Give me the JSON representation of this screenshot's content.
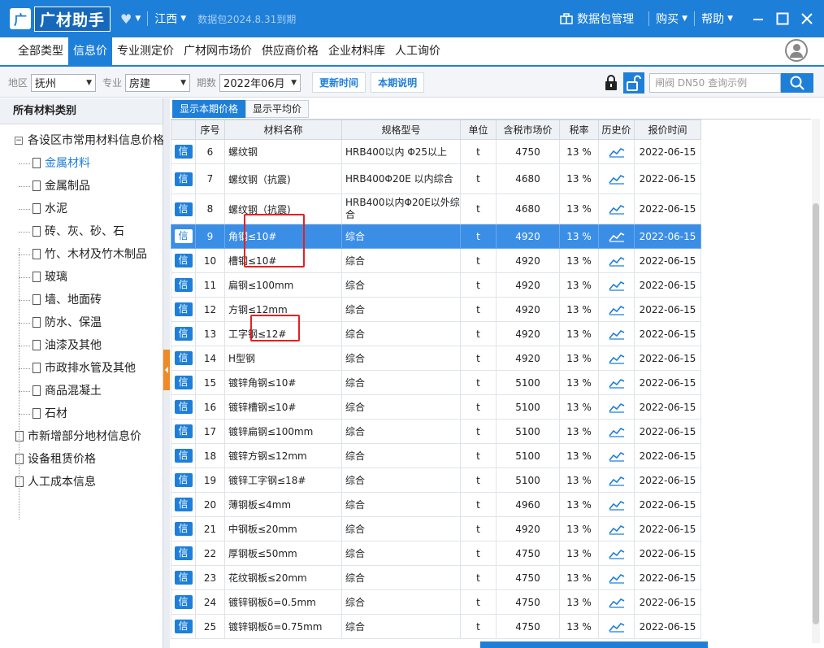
{
  "app": {
    "logo_mark": "广",
    "name": "广材助手",
    "region": "江西",
    "expiry": "数据包2024.8.31到期",
    "data_pkg": "数据包管理",
    "buy": "购买",
    "help": "帮助"
  },
  "menu": [
    "全部类型",
    "信息价",
    "专业测定价",
    "广材网市场价",
    "供应商价格",
    "企业材料库",
    "人工询价"
  ],
  "filters": {
    "region_label": "地区",
    "region_value": "抚州",
    "major_label": "专业",
    "major_value": "房建",
    "period_label": "期数",
    "period_value": "2022年06月",
    "update_time": "更新时间",
    "period_note": "本期说明",
    "search_placeholder": "闸阀 DN50 查询示例"
  },
  "tree": {
    "header": "所有材料类别",
    "root": "各设区市常用材料信息价格",
    "children": [
      "金属材料",
      "金属制品",
      "水泥",
      "砖、灰、砂、石",
      "竹、木材及竹木制品",
      "玻璃",
      "墙、地面砖",
      "防水、保温",
      "油漆及其他",
      "市政排水管及其他",
      "商品混凝土",
      "石材"
    ],
    "roots": [
      "市新增部分地材信息价",
      "设备租赁价格",
      "人工成本信息"
    ]
  },
  "subtabs": [
    "显示本期价格",
    "显示平均价"
  ],
  "table": {
    "headers": [
      "",
      "序号",
      "材料名称",
      "规格型号",
      "单位",
      "含税市场价",
      "税率",
      "历史价",
      "报价时间"
    ],
    "badge": "信",
    "rows": [
      {
        "no": "6",
        "name": "螺纹钢",
        "spec": "HRB400以内 Φ25以上",
        "unit": "t",
        "price": "4750",
        "tax": "13 %",
        "date": "2022-06-15"
      },
      {
        "no": "7",
        "name": "螺纹钢（抗震)",
        "spec": "HRB400Φ20E 以内综合",
        "unit": "t",
        "price": "4680",
        "tax": "13 %",
        "date": "2022-06-15"
      },
      {
        "no": "8",
        "name": "螺纹钢（抗震)",
        "spec": "HRB400以内Φ20E以外综合",
        "unit": "t",
        "price": "4680",
        "tax": "13 %",
        "date": "2022-06-15"
      },
      {
        "no": "9",
        "name": "角钢≤10#",
        "spec": "综合",
        "unit": "t",
        "price": "4920",
        "tax": "13 %",
        "date": "2022-06-15"
      },
      {
        "no": "10",
        "name": "槽钢≤10#",
        "spec": "综合",
        "unit": "t",
        "price": "4920",
        "tax": "13 %",
        "date": "2022-06-15"
      },
      {
        "no": "11",
        "name": "扁钢≤100mm",
        "spec": "综合",
        "unit": "t",
        "price": "4920",
        "tax": "13 %",
        "date": "2022-06-15"
      },
      {
        "no": "12",
        "name": "方钢≤12mm",
        "spec": "综合",
        "unit": "t",
        "price": "4920",
        "tax": "13 %",
        "date": "2022-06-15"
      },
      {
        "no": "13",
        "name": "工字钢≤12#",
        "spec": "综合",
        "unit": "t",
        "price": "4920",
        "tax": "13 %",
        "date": "2022-06-15"
      },
      {
        "no": "14",
        "name": "H型钢",
        "spec": "综合",
        "unit": "t",
        "price": "4920",
        "tax": "13 %",
        "date": "2022-06-15"
      },
      {
        "no": "15",
        "name": "镀锌角钢≤10#",
        "spec": "综合",
        "unit": "t",
        "price": "5100",
        "tax": "13 %",
        "date": "2022-06-15"
      },
      {
        "no": "16",
        "name": "镀锌槽钢≤10#",
        "spec": "综合",
        "unit": "t",
        "price": "5100",
        "tax": "13 %",
        "date": "2022-06-15"
      },
      {
        "no": "17",
        "name": "镀锌扁钢≤100mm",
        "spec": "综合",
        "unit": "t",
        "price": "5100",
        "tax": "13 %",
        "date": "2022-06-15"
      },
      {
        "no": "18",
        "name": "镀锌方钢≤12mm",
        "spec": "综合",
        "unit": "t",
        "price": "5100",
        "tax": "13 %",
        "date": "2022-06-15"
      },
      {
        "no": "19",
        "name": "镀锌工字钢≤18#",
        "spec": "综合",
        "unit": "t",
        "price": "5100",
        "tax": "13 %",
        "date": "2022-06-15"
      },
      {
        "no": "20",
        "name": "薄钢板≤4mm",
        "spec": "综合",
        "unit": "t",
        "price": "4960",
        "tax": "13 %",
        "date": "2022-06-15"
      },
      {
        "no": "21",
        "name": "中钢板≤20mm",
        "spec": "综合",
        "unit": "t",
        "price": "4920",
        "tax": "13 %",
        "date": "2022-06-15"
      },
      {
        "no": "22",
        "name": "厚钢板≤50mm",
        "spec": "综合",
        "unit": "t",
        "price": "4750",
        "tax": "13 %",
        "date": "2022-06-15"
      },
      {
        "no": "23",
        "name": "花纹钢板≤20mm",
        "spec": "综合",
        "unit": "t",
        "price": "4750",
        "tax": "13 %",
        "date": "2022-06-15"
      },
      {
        "no": "24",
        "name": "镀锌钢板δ=0.5mm",
        "spec": "综合",
        "unit": "t",
        "price": "4750",
        "tax": "13 %",
        "date": "2022-06-15"
      },
      {
        "no": "25",
        "name": "镀锌钢板δ=0.75mm",
        "spec": "综合",
        "unit": "t",
        "price": "4750",
        "tax": "13 %",
        "date": "2022-06-15"
      }
    ]
  },
  "colors": {
    "primary": "#1e7fd9",
    "selected_row": "#3b8ee6",
    "annotation": "#e62020",
    "splitter_handle": "#f08a24"
  }
}
